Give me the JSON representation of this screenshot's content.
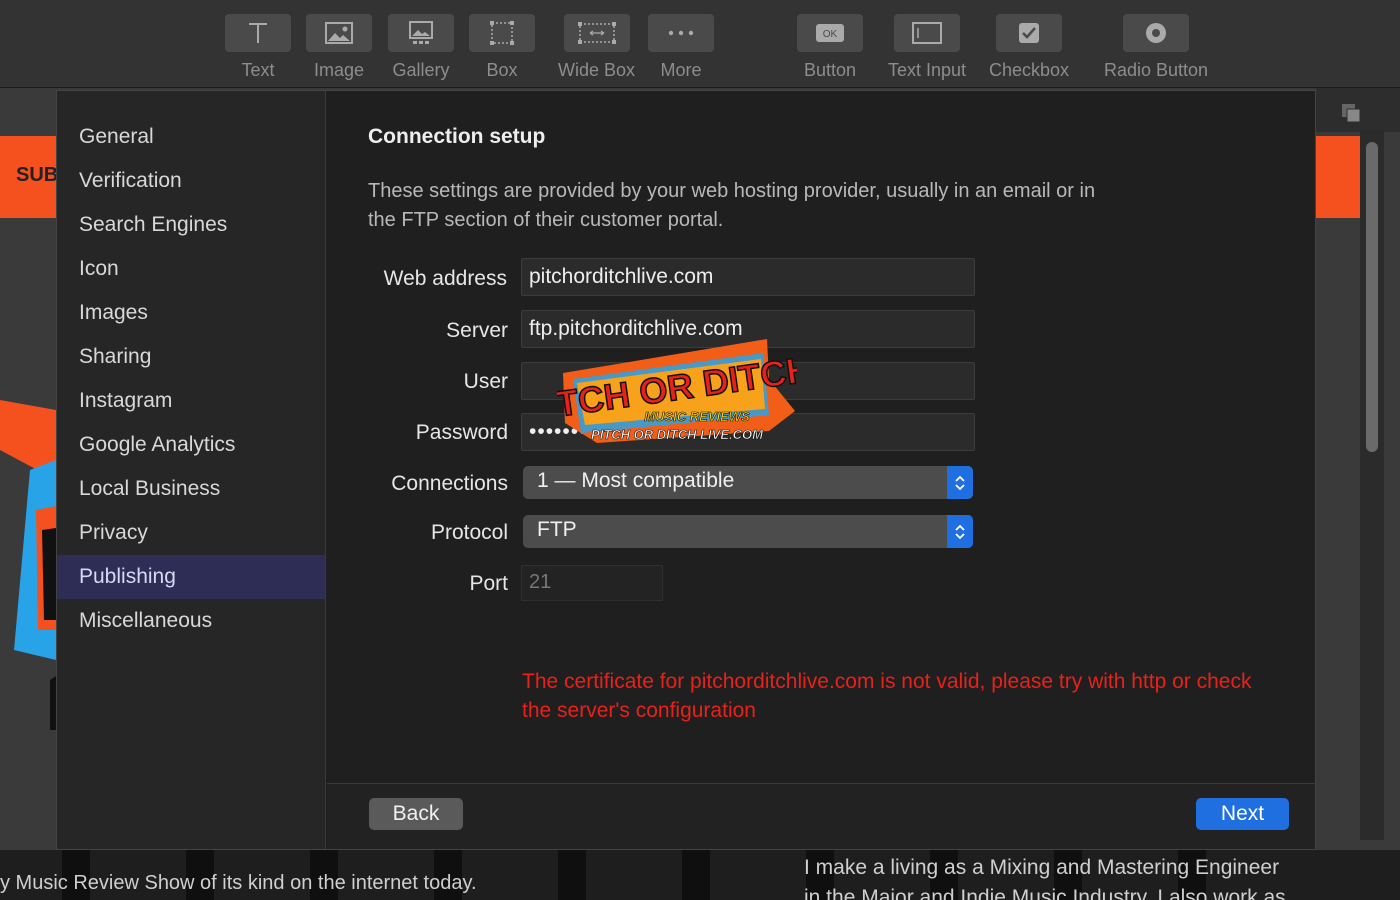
{
  "toolbar": {
    "items": [
      {
        "label": "Text",
        "icon": "text-icon"
      },
      {
        "label": "Image",
        "icon": "image-icon"
      },
      {
        "label": "Gallery",
        "icon": "gallery-icon"
      },
      {
        "label": "Box",
        "icon": "box-icon"
      },
      {
        "label": "Wide Box",
        "icon": "wide-box-icon"
      },
      {
        "label": "More",
        "icon": "more-icon"
      },
      {
        "label": "Button",
        "icon": "button-icon"
      },
      {
        "label": "Text Input",
        "icon": "text-input-icon"
      },
      {
        "label": "Checkbox",
        "icon": "checkbox-icon"
      },
      {
        "label": "Radio Button",
        "icon": "radio-button-icon"
      }
    ]
  },
  "background": {
    "sub_text": "SUB",
    "bottom_left_text": "y Music Review Show of its kind on the internet today.",
    "bottom_right_text": "I make a living as a Mixing and Mastering Engineer",
    "bottom_right_text2": "in the Major and Indie Music Industry. I also work as",
    "accent_orange": "#f4511e"
  },
  "sidebar": {
    "items": [
      {
        "label": "General",
        "active": false
      },
      {
        "label": "Verification",
        "active": false
      },
      {
        "label": "Search Engines",
        "active": false
      },
      {
        "label": "Icon",
        "active": false
      },
      {
        "label": "Images",
        "active": false
      },
      {
        "label": "Sharing",
        "active": false
      },
      {
        "label": "Instagram",
        "active": false
      },
      {
        "label": "Google Analytics",
        "active": false
      },
      {
        "label": "Local Business",
        "active": false
      },
      {
        "label": "Privacy",
        "active": false
      },
      {
        "label": "Publishing",
        "active": true
      },
      {
        "label": "Miscellaneous",
        "active": false
      }
    ]
  },
  "content": {
    "title": "Connection setup",
    "description": "These settings are provided by your web hosting provider, usually in an email or in the FTP section of their customer portal.",
    "fields": {
      "web_address": {
        "label": "Web address",
        "value": "pitchorditchlive.com"
      },
      "server": {
        "label": "Server",
        "value": "ftp.pitchorditchlive.com"
      },
      "user": {
        "label": "User",
        "value": ""
      },
      "password": {
        "label": "Password",
        "value": "••••••••••••"
      },
      "connections": {
        "label": "Connections",
        "value": "1 — Most compatible"
      },
      "protocol": {
        "label": "Protocol",
        "value": "FTP"
      },
      "port": {
        "label": "Port",
        "placeholder": "21"
      }
    },
    "error": "The certificate for pitchorditchlive.com is not valid, please try with http or check the server's configuration",
    "error_color": "#e8211b"
  },
  "logo": {
    "line1": "PITCH OR DITCH",
    "line2": "MUSIC REVIEWS",
    "line3": "PITCH OR DITCH LIVE.COM"
  },
  "footer": {
    "back_label": "Back",
    "next_label": "Next",
    "accent_blue": "#1f6fe0"
  }
}
